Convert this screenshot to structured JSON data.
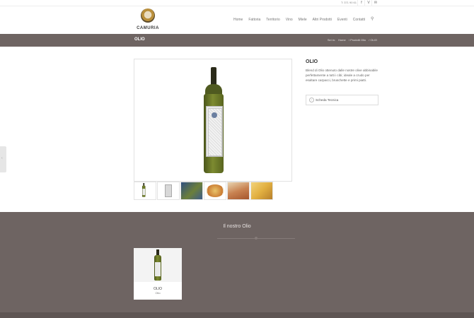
{
  "topbar": {
    "phone": "T: 371 90 61",
    "social": [
      {
        "icon": "facebook-icon",
        "glyph": "f"
      },
      {
        "icon": "vimeo-icon",
        "glyph": "V"
      },
      {
        "icon": "mail-icon",
        "glyph": "✉"
      }
    ]
  },
  "header": {
    "logo_top": "FATTORIA",
    "logo_brand": "CAMURIA",
    "nav": [
      "Home",
      "Fattoria",
      "Territorio",
      "Vino",
      "Miele",
      "Altri Prodotti",
      "Eventi",
      "Contatti"
    ]
  },
  "titlebar": {
    "title": "OLIO",
    "crumb_prefix": "Sei in:",
    "crumbs": [
      "Home",
      "/ Prodotti Olio",
      "/ OLIO"
    ]
  },
  "product": {
    "name": "OLIO",
    "description": "Blend di Olio ottenuto dalle nostre olive abbinabile perfettamente a tutti i cibi; ideale a crudo per esaltare carpacci, bruschette e primi piatti.",
    "tab_label": "Scheda Tecnica",
    "thumbnails": [
      {
        "name": "thumb-bottle",
        "color": "#ffffff"
      },
      {
        "name": "thumb-can",
        "color": "#f1f1f1"
      },
      {
        "name": "thumb-olives",
        "color": "#3d5b8a"
      },
      {
        "name": "thumb-pizza",
        "color": "#d6a449"
      },
      {
        "name": "thumb-bruschetta",
        "color": "#c98352"
      },
      {
        "name": "thumb-cheese",
        "color": "#e2b041"
      }
    ]
  },
  "related": {
    "title": "Il nostro Olio",
    "card_name": "OLIO",
    "card_category": "Olio"
  },
  "colors": {
    "titlebar_bg": "#6e6462",
    "footer_bg": "#6e6462"
  }
}
